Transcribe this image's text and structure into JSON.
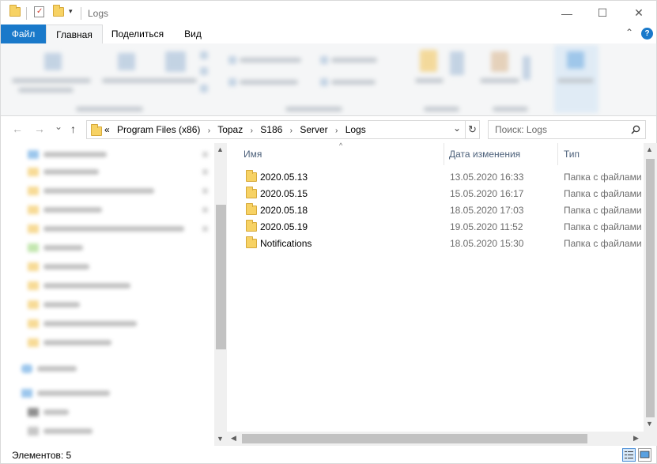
{
  "window": {
    "title": "Logs",
    "minimize": "—",
    "maximize": "☐",
    "close": "✕"
  },
  "ribbon": {
    "tabs": [
      "Файл",
      "Главная",
      "Поделиться",
      "Вид"
    ],
    "collapse_glyph": "⌃",
    "help_glyph": "?"
  },
  "address": {
    "back": "←",
    "forward": "→",
    "recent": "⌄",
    "up": "↑",
    "overflow": "«",
    "crumbs": [
      "Program Files (x86)",
      "Topaz",
      "S186",
      "Server",
      "Logs"
    ],
    "separator": "›",
    "dropdown": "⌄",
    "refresh": "↻",
    "search_placeholder": "Поиск: Logs"
  },
  "columns": {
    "name": "Имя",
    "date": "Дата изменения",
    "type": "Тип"
  },
  "files": [
    {
      "name": "2020.05.13",
      "date": "13.05.2020 16:33",
      "type": "Папка с файлами"
    },
    {
      "name": "2020.05.15",
      "date": "15.05.2020 16:17",
      "type": "Папка с файлами"
    },
    {
      "name": "2020.05.18",
      "date": "18.05.2020 17:03",
      "type": "Папка с файлами"
    },
    {
      "name": "2020.05.19",
      "date": "19.05.2020 11:52",
      "type": "Папка с файлами"
    },
    {
      "name": "Notifications",
      "date": "18.05.2020 15:30",
      "type": "Папка с файлами"
    }
  ],
  "status": {
    "item_count": "Элементов: 5"
  },
  "colors": {
    "file_tab": "#1979ca",
    "folder": "#f7d264",
    "header_text": "#4c607a"
  }
}
